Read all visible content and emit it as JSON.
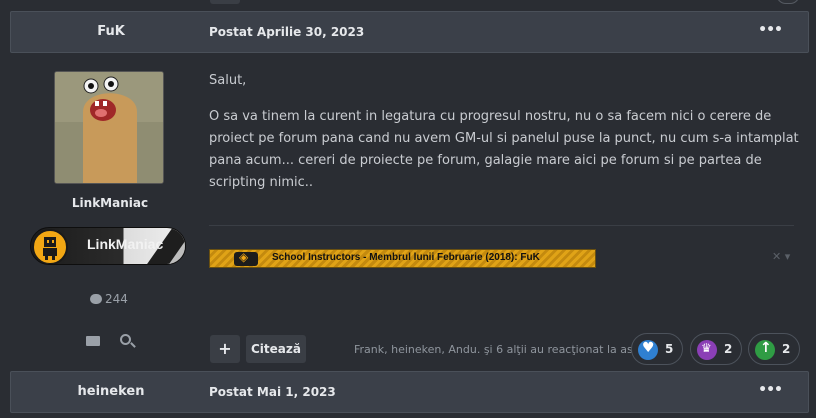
{
  "post1": {
    "author": "FuK",
    "date": "Postat Aprilie 30, 2023",
    "menu": "•••",
    "user": {
      "name": "LinkManiac",
      "rank_label": "LinkManiac",
      "post_count": "244"
    },
    "content": {
      "greeting": "Salut,",
      "body": "O sa va tinem la curent in legatura cu progresul nostru, nu o sa facem nici o cerere de proiect pe forum pana cand nu avem GM-ul si panelul puse la punct, nu cum s-a intamplat pana acum... cereri de proiecte pe forum, galagie mare aici pe forum si pe partea de scripting nimic.."
    },
    "signature": {
      "award_text": "School Instructors - Membrul lunii Februarie (2018): FuK",
      "close": "✕ ▾"
    },
    "actions": {
      "plus": "+",
      "quote": "Citează",
      "reactions_text": "Frank, heineken, Andu. şi 6 alţii au reacţionat la asta",
      "reactions": [
        {
          "icon": "heart-icon",
          "count": "5",
          "color": "#2f80d1"
        },
        {
          "icon": "trophy-icon",
          "count": "2",
          "color": "#8b3fb6"
        },
        {
          "icon": "arrow-up-icon",
          "count": "2",
          "color": "#2f9c44"
        }
      ]
    }
  },
  "post2": {
    "author": "heineken",
    "date": "Postat Mai 1, 2023",
    "menu": "•••"
  }
}
